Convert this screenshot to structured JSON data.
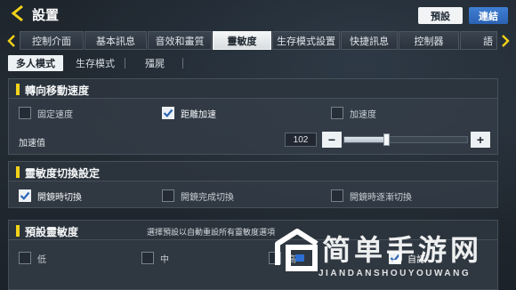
{
  "header": {
    "title": "設置",
    "preset_label": "預設",
    "link_label": "連結"
  },
  "tabs": [
    {
      "label": "控制介面",
      "active": false
    },
    {
      "label": "基本訊息",
      "active": false
    },
    {
      "label": "音效和畫質",
      "active": false
    },
    {
      "label": "靈敏度",
      "active": true
    },
    {
      "label": "生存模式設置",
      "active": false
    },
    {
      "label": "快捷訊息",
      "active": false
    },
    {
      "label": "控制器",
      "active": false
    },
    {
      "label": "語",
      "active": false
    }
  ],
  "subtabs": [
    {
      "label": "多人模式",
      "active": true
    },
    {
      "label": "生存模式",
      "active": false
    },
    {
      "label": "殭屍",
      "active": false
    }
  ],
  "turn_speed": {
    "title": "轉向移動速度",
    "options": [
      {
        "label": "固定速度",
        "checked": false
      },
      {
        "label": "距離加速",
        "checked": true
      },
      {
        "label": "加速度",
        "checked": false
      }
    ],
    "accel_label": "加速值",
    "accel_value": "102",
    "minus_label": "−",
    "plus_label": "+",
    "slider_fraction": 0.34
  },
  "switch_settings": {
    "title": "靈敏度切換設定",
    "options": [
      {
        "label": "開鏡時切換",
        "checked": true
      },
      {
        "label": "開鏡完成切換",
        "checked": false
      },
      {
        "label": "開鏡時逐漸切換",
        "checked": false
      }
    ]
  },
  "preset_sensitivity": {
    "title": "預設靈敏度",
    "description": "選擇預設以自動重設所有靈敏度選項",
    "options": [
      {
        "label": "低",
        "checked": false
      },
      {
        "label": "中",
        "checked": false
      },
      {
        "label": "高",
        "checked": false
      },
      {
        "label": "自訂",
        "checked": true
      }
    ]
  },
  "watermark": {
    "cn": "简单手游网",
    "en": "JIANDANSHOUYOUWANG"
  },
  "colors": {
    "accent_yellow": "#f2d21a",
    "link_blue": "#2c62b3"
  }
}
